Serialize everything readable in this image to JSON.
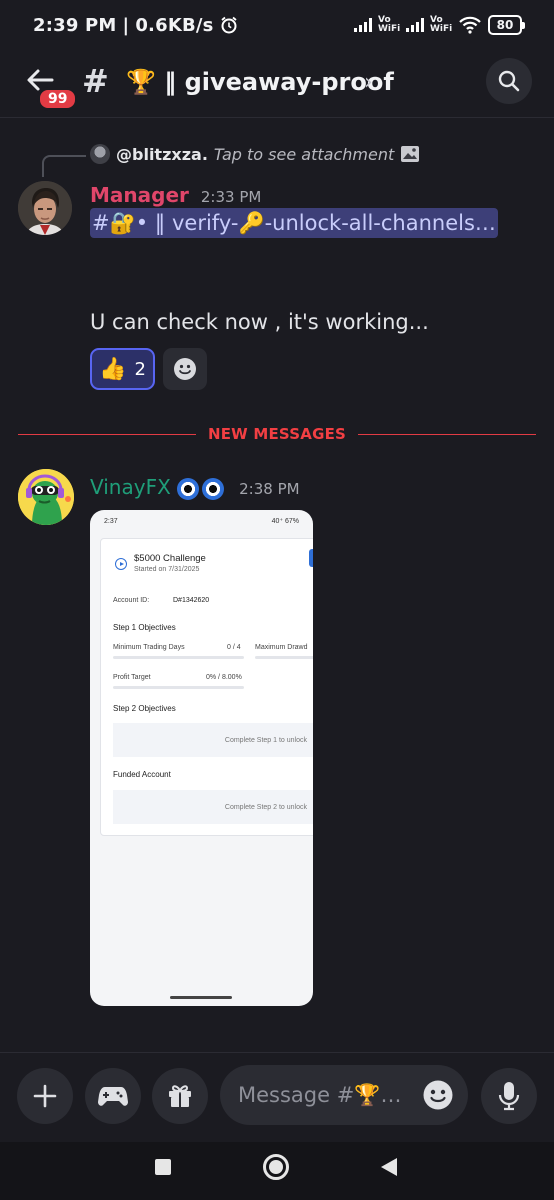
{
  "status_bar": {
    "time": "2:39 PM",
    "speed": "0.6KB/s",
    "vowifi_1": "Vo WiFi",
    "vowifi_2": "Vo WiFi",
    "battery": "80"
  },
  "header": {
    "back_icon": "arrow-left-icon",
    "unread_badge": "99",
    "hash": "#",
    "channel_name": "🏆 ‖ giveaway-proof",
    "chevron": "›",
    "search_icon": "search-icon"
  },
  "reply": {
    "user": "@blitzxza.",
    "note": "Tap to see attachment",
    "image_icon": "image-icon"
  },
  "message_1": {
    "username": "Manager",
    "username_color": "#e0466a",
    "time": "2:33 PM",
    "channel_mention": "#🔐• ‖ verify-🔑-unlock-all-channels…",
    "text": "U can check now , it's working...",
    "reaction_emoji": "👍",
    "reaction_count": "2",
    "add_reaction_icon": "smiley-icon"
  },
  "divider": {
    "label": "NEW MESSAGES",
    "color": "#f23f43"
  },
  "message_2": {
    "username": "VinayFX",
    "username_color": "#1f9e79",
    "time": "2:38 PM",
    "attachment": {
      "status_time": "2:37",
      "status_right": "40⁺ 67%",
      "title": "$5000 Challenge",
      "started": "Started on 7/31/2025",
      "account_label": "Account ID:",
      "account_value": "D#1342620",
      "step1": "Step 1 Objectives",
      "min_days_label": "Minimum Trading Days",
      "min_days_value": "0 / 4",
      "max_draw": "Maximum Drawd",
      "profit_label": "Profit Target",
      "profit_value": "0% / 8.00%",
      "step2": "Step 2 Objectives",
      "step2_lock": "Complete Step 1 to unlock",
      "funded": "Funded Account",
      "funded_lock": "Complete Step 2 to unlock"
    }
  },
  "composer": {
    "placeholder": "Message #🏆…",
    "plus_icon": "plus-icon",
    "game_icon": "gamepad-icon",
    "gift_icon": "gift-icon",
    "emoji_icon": "smiley-icon",
    "mic_icon": "microphone-icon"
  }
}
